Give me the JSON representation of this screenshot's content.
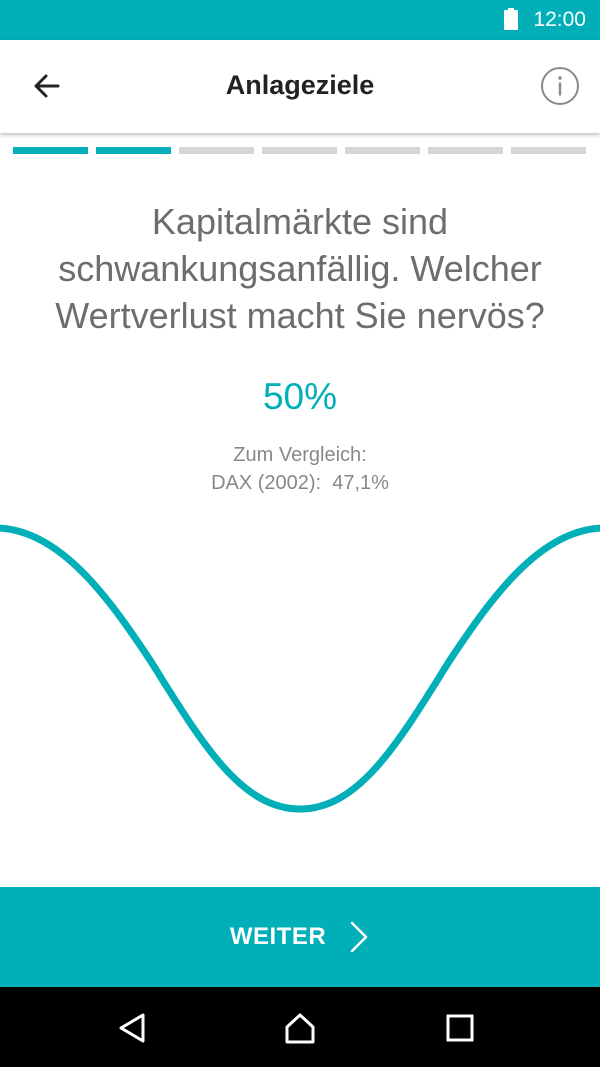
{
  "status_bar": {
    "time": "12:00",
    "icons": [
      "battery-icon"
    ]
  },
  "app_bar": {
    "title": "Anlageziele",
    "left_icon": "back-arrow-icon",
    "right_icon": "info-icon"
  },
  "progress": {
    "total_steps": 7,
    "completed_steps": 2
  },
  "question": {
    "text": "Kapitalmärkte sind schwankungsanfällig. Welcher Wertverlust macht Sie nervös?"
  },
  "selection": {
    "value": "50%",
    "comparison_label": "Zum Vergleich:",
    "comparison_value": "DAX (2002):  47,1%"
  },
  "footer": {
    "button_label": "WEITER",
    "button_icon": "chevron-right-icon"
  },
  "system_nav": {
    "icons": [
      "back-triangle-icon",
      "home-icon",
      "recents-icon"
    ]
  },
  "colors": {
    "accent": "#00afb8",
    "text_gray": "#6d6d6d",
    "inactive_step": "#d5d5d5"
  }
}
